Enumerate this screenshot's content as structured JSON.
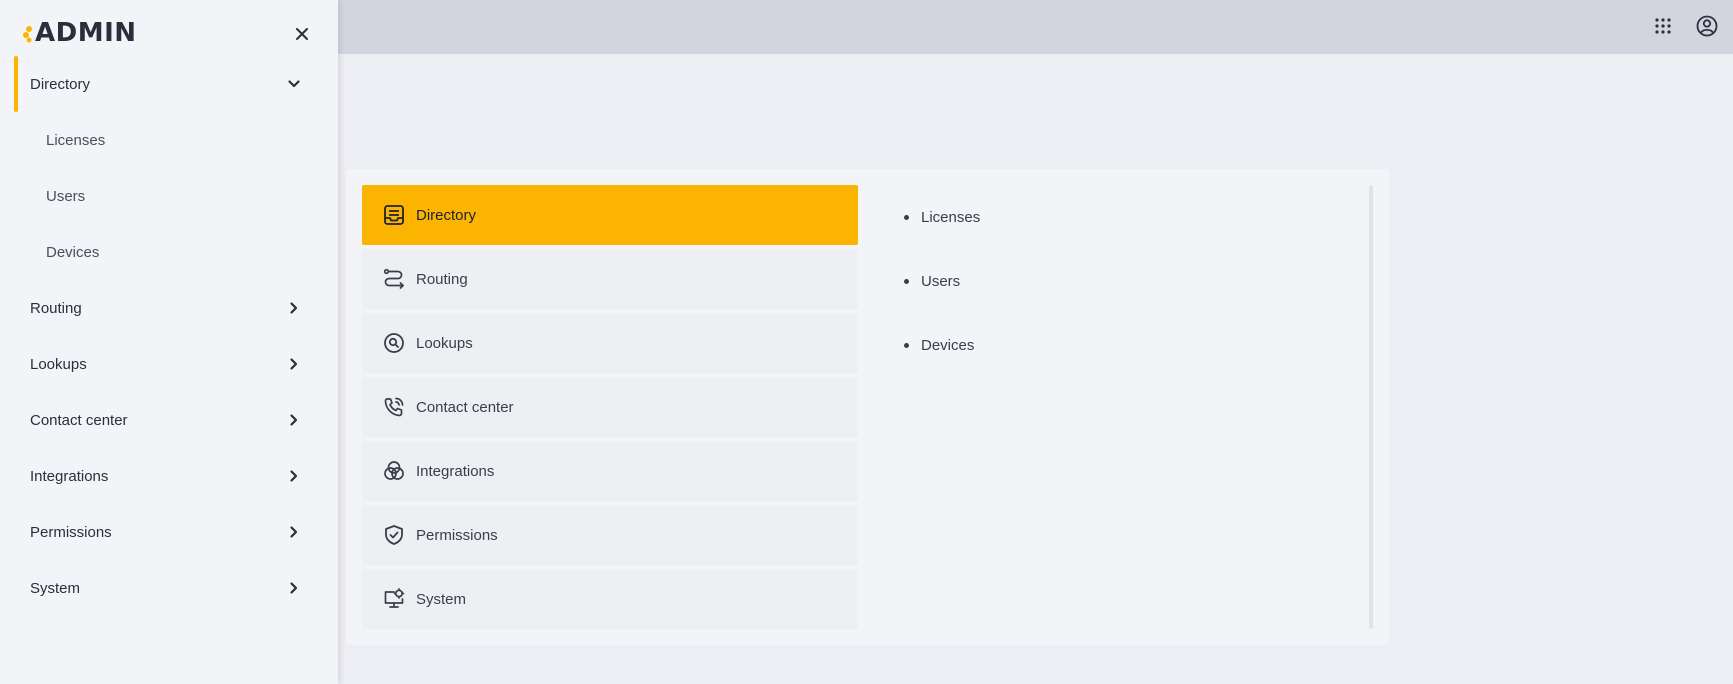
{
  "app": {
    "logo_text": "ADMIN"
  },
  "sidebar": {
    "items": [
      {
        "label": "Directory",
        "expanded": true,
        "subitems": [
          "Licenses",
          "Users",
          "Devices"
        ]
      },
      {
        "label": "Routing"
      },
      {
        "label": "Lookups"
      },
      {
        "label": "Contact center"
      },
      {
        "label": "Integrations"
      },
      {
        "label": "Permissions"
      },
      {
        "label": "System"
      }
    ]
  },
  "main": {
    "menu": [
      {
        "label": "Directory",
        "icon": "directory-icon",
        "active": true
      },
      {
        "label": "Routing",
        "icon": "routing-icon"
      },
      {
        "label": "Lookups",
        "icon": "lookups-icon"
      },
      {
        "label": "Contact center",
        "icon": "contact-center-icon"
      },
      {
        "label": "Integrations",
        "icon": "integrations-icon"
      },
      {
        "label": "Permissions",
        "icon": "permissions-icon"
      },
      {
        "label": "System",
        "icon": "system-icon"
      }
    ],
    "submenu": [
      "Licenses",
      "Users",
      "Devices"
    ]
  },
  "topbar": {
    "icons": [
      "apps-grid-icon",
      "user-account-icon"
    ]
  },
  "colors": {
    "accent": "#fbb400",
    "topbar": "#d2d5df",
    "sidebar": "#f3f4f8",
    "background": "#edeef3"
  }
}
